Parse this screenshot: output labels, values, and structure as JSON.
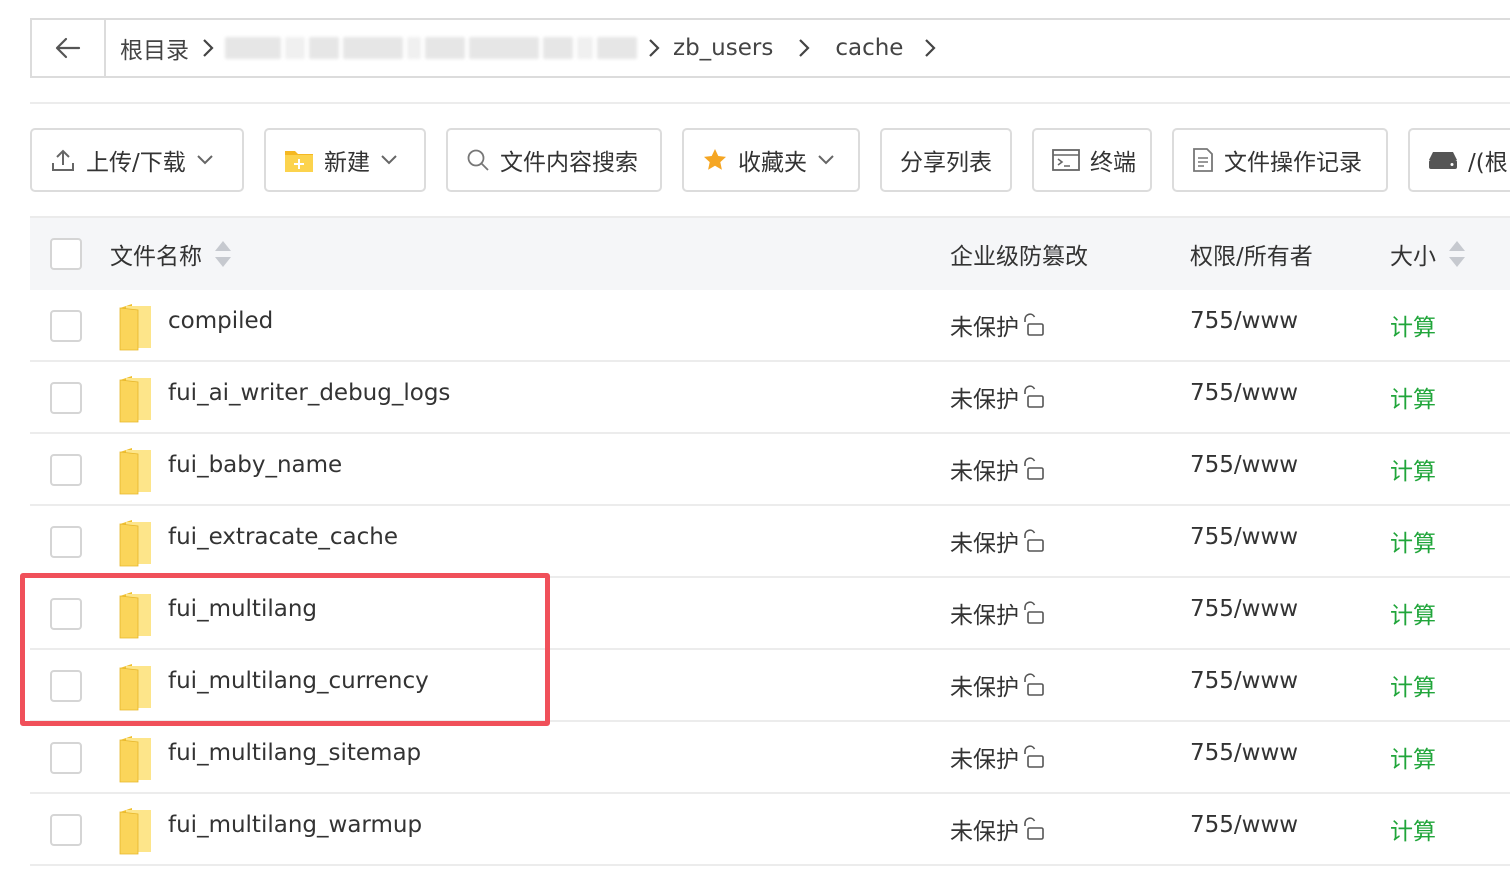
{
  "breadcrumb": {
    "root": "根目录",
    "items": [
      "zb_users",
      "cache"
    ]
  },
  "toolbar": {
    "upload": "上传/下载",
    "new": "新建",
    "search": "文件内容搜索",
    "favorites": "收藏夹",
    "share": "分享列表",
    "terminal": "终端",
    "oplog": "文件操作记录",
    "disk": "/(根"
  },
  "table": {
    "headers": {
      "name": "文件名称",
      "protect": "企业级防篡改",
      "perm": "权限/所有者",
      "size": "大小"
    },
    "rows": [
      {
        "name": "compiled",
        "protect": "未保护",
        "perm": "755/www",
        "size": "计算"
      },
      {
        "name": "fui_ai_writer_debug_logs",
        "protect": "未保护",
        "perm": "755/www",
        "size": "计算"
      },
      {
        "name": "fui_baby_name",
        "protect": "未保护",
        "perm": "755/www",
        "size": "计算"
      },
      {
        "name": "fui_extracate_cache",
        "protect": "未保护",
        "perm": "755/www",
        "size": "计算"
      },
      {
        "name": "fui_multilang",
        "protect": "未保护",
        "perm": "755/www",
        "size": "计算"
      },
      {
        "name": "fui_multilang_currency",
        "protect": "未保护",
        "perm": "755/www",
        "size": "计算"
      },
      {
        "name": "fui_multilang_sitemap",
        "protect": "未保护",
        "perm": "755/www",
        "size": "计算"
      },
      {
        "name": "fui_multilang_warmup",
        "protect": "未保护",
        "perm": "755/www",
        "size": "计算"
      }
    ]
  },
  "colors": {
    "accent_green": "#20a53a",
    "highlight_red": "#f0505a"
  }
}
